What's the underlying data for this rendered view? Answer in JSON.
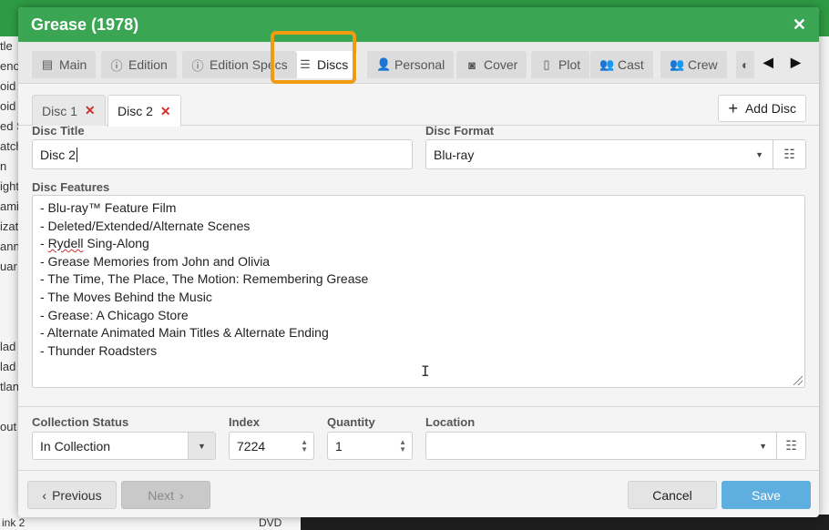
{
  "dialog": {
    "title": "Grease (1978)",
    "close_icon": "close-icon"
  },
  "tabs": [
    {
      "label": "Main",
      "icon": "film-icon",
      "glyph": "▤"
    },
    {
      "label": "Edition",
      "icon": "info-icon",
      "glyph": "ⓘ"
    },
    {
      "label": "Edition Specs",
      "icon": "info-icon",
      "glyph": "ⓘ"
    },
    {
      "label": "Discs",
      "icon": "list-icon",
      "glyph": "☰",
      "active": true
    },
    {
      "label": "Personal",
      "icon": "person-icon",
      "glyph": "👤"
    },
    {
      "label": "Cover",
      "icon": "camera-icon",
      "glyph": "◙"
    },
    {
      "label": "Plot",
      "icon": "document-icon",
      "glyph": "▯"
    },
    {
      "label": "Cast",
      "icon": "people-icon",
      "glyph": "👥"
    },
    {
      "label": "Crew",
      "icon": "people-icon",
      "glyph": "👥"
    }
  ],
  "disc_tabs": [
    {
      "label": "Disc 1",
      "active": false
    },
    {
      "label": "Disc 2",
      "active": true
    }
  ],
  "add_disc_label": "Add Disc",
  "form": {
    "disc_title_label": "Disc Title",
    "disc_title_value": "Disc 2",
    "disc_format_label": "Disc Format",
    "disc_format_value": "Blu-ray",
    "disc_features_label": "Disc Features",
    "disc_features": [
      "- Blu-ray™ Feature Film",
      "- Deleted/Extended/Alternate Scenes",
      "- Rydell Sing-Along",
      "- Grease Memories from John and Olivia",
      "- The Time, The Place, The Motion: Remembering Grease",
      "- The Moves Behind the Music",
      "- Grease: A Chicago Store",
      "- Alternate Animated Main Titles & Alternate Ending",
      "- Thunder Roadsters"
    ],
    "collection_status_label": "Collection Status",
    "collection_status_value": "In Collection",
    "index_label": "Index",
    "index_value": "7224",
    "quantity_label": "Quantity",
    "quantity_value": "1",
    "location_label": "Location",
    "location_value": ""
  },
  "footer": {
    "previous_label": "Previous",
    "next_label": "Next",
    "cancel_label": "Cancel",
    "save_label": "Save"
  },
  "background": {
    "left_rows": [
      "tle",
      "eno",
      "oid",
      "oid",
      "ed S",
      "atch",
      "n",
      "ight",
      "ami",
      "izat",
      "ann",
      "uar",
      "",
      "",
      "",
      "lad",
      "lad",
      "tlan",
      "",
      "out"
    ],
    "bottom_left": "ink 2",
    "bottom_mid": "DVD"
  },
  "colors": {
    "title_bar": "#3aa653",
    "highlight": "#f29b10",
    "save": "#5eaee0",
    "remove_x": "#d03030"
  }
}
